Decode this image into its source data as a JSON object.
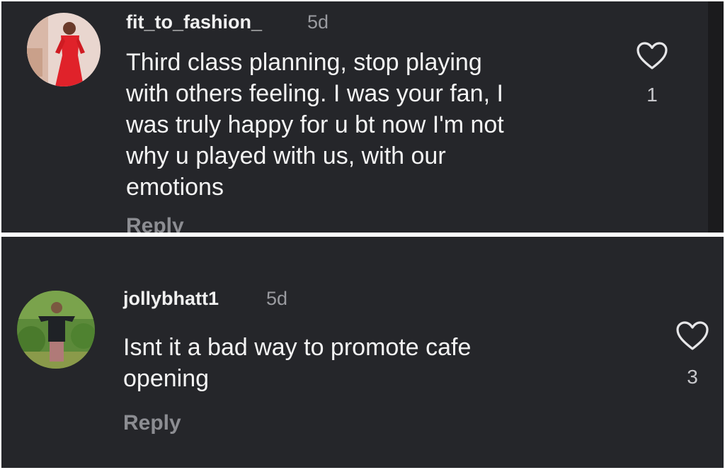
{
  "comments": [
    {
      "username": "fit_to_fashion_",
      "time": "5d",
      "text": "Third class planning, stop playing\nwith others feeling. I was your fan, I\nwas truly happy for u bt now I'm not\nwhy u played with us, with our\nemotions",
      "reply_label": "Reply",
      "likes": "1",
      "avatar_icon": "profile-photo-red-dress"
    },
    {
      "username": "jollybhatt1",
      "time": "5d",
      "text": "Isnt it a bad way to promote cafe\nopening",
      "reply_label": "Reply",
      "likes": "3",
      "avatar_icon": "profile-photo-person-outdoors"
    }
  ],
  "colors": {
    "background": "#25262a",
    "text": "#f4f4f4",
    "muted": "#8c8d92"
  }
}
